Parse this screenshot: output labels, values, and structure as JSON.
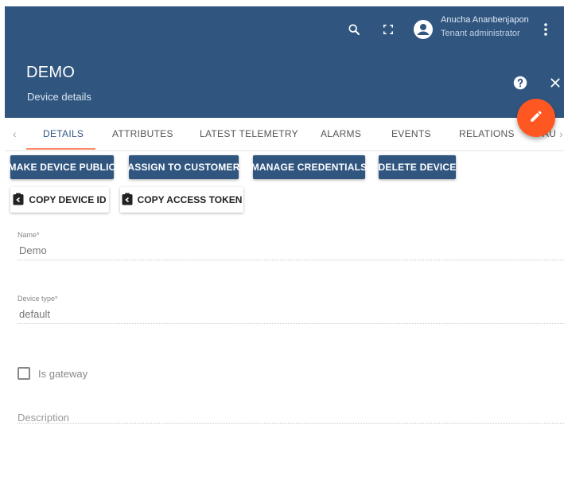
{
  "header": {
    "user_name": "Anucha Ananbenjapon",
    "user_role": "Tenant administrator",
    "title": "DEMO",
    "subtitle": "Device details",
    "icons": [
      "search-icon",
      "fullscreen-icon",
      "account-icon",
      "more-vert-icon",
      "help-icon",
      "close-icon",
      "edit-icon"
    ]
  },
  "tabs": [
    {
      "label": "DETAILS",
      "active": true
    },
    {
      "label": "ATTRIBUTES"
    },
    {
      "label": "LATEST TELEMETRY"
    },
    {
      "label": "ALARMS"
    },
    {
      "label": "EVENTS"
    },
    {
      "label": "RELATIONS"
    },
    {
      "label": "AU"
    }
  ],
  "actions": {
    "make_public": "MAKE DEVICE PUBLIC",
    "assign_customer": "ASSIGN TO CUSTOMER",
    "manage_credentials": "MANAGE CREDENTIALS",
    "delete_device": "DELETE DEVICE",
    "copy_id": "COPY DEVICE ID",
    "copy_token": "COPY ACCESS TOKEN"
  },
  "form": {
    "name_label": "Name",
    "name_value": "Demo",
    "type_label": "Device type",
    "type_value": "default",
    "required_mark": "*",
    "gateway_label": "Is gateway",
    "gateway_checked": false,
    "description_label": "Description"
  },
  "colors": {
    "header": "#305680",
    "fab": "#ff5722",
    "tab_ink": "#ff8a65"
  }
}
